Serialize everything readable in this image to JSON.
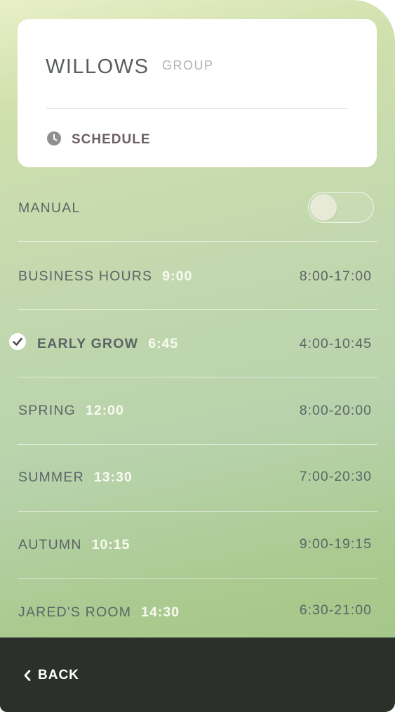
{
  "header": {
    "title": "WILLOWS",
    "subtitle": "GROUP",
    "schedule_link": "SCHEDULE",
    "schedule_icon": "clock-icon"
  },
  "manual": {
    "label": "MANUAL",
    "enabled": false
  },
  "schedules": [
    {
      "name": "BUSINESS HOURS",
      "time": "9:00",
      "range": "8:00-17:00",
      "selected": false
    },
    {
      "name": "EARLY GROW",
      "time": "6:45",
      "range": "4:00-10:45",
      "selected": true
    },
    {
      "name": "SPRING",
      "time": "12:00",
      "range": "8:00-20:00",
      "selected": false
    },
    {
      "name": "SUMMER",
      "time": "13:30",
      "range": "7:00-20:30",
      "selected": false
    },
    {
      "name": "AUTUMN",
      "time": "10:15",
      "range": "9:00-19:15",
      "selected": false
    },
    {
      "name": "JARED'S ROOM",
      "time": "14:30",
      "range": "6:30-21:00",
      "selected": false
    }
  ],
  "footer": {
    "back_label": "BACK",
    "back_icon": "chevron-left-icon"
  },
  "colors": {
    "footer_bg": "#2c302b",
    "accent_text": "#f7faf0",
    "label_text": "#5b6566"
  }
}
